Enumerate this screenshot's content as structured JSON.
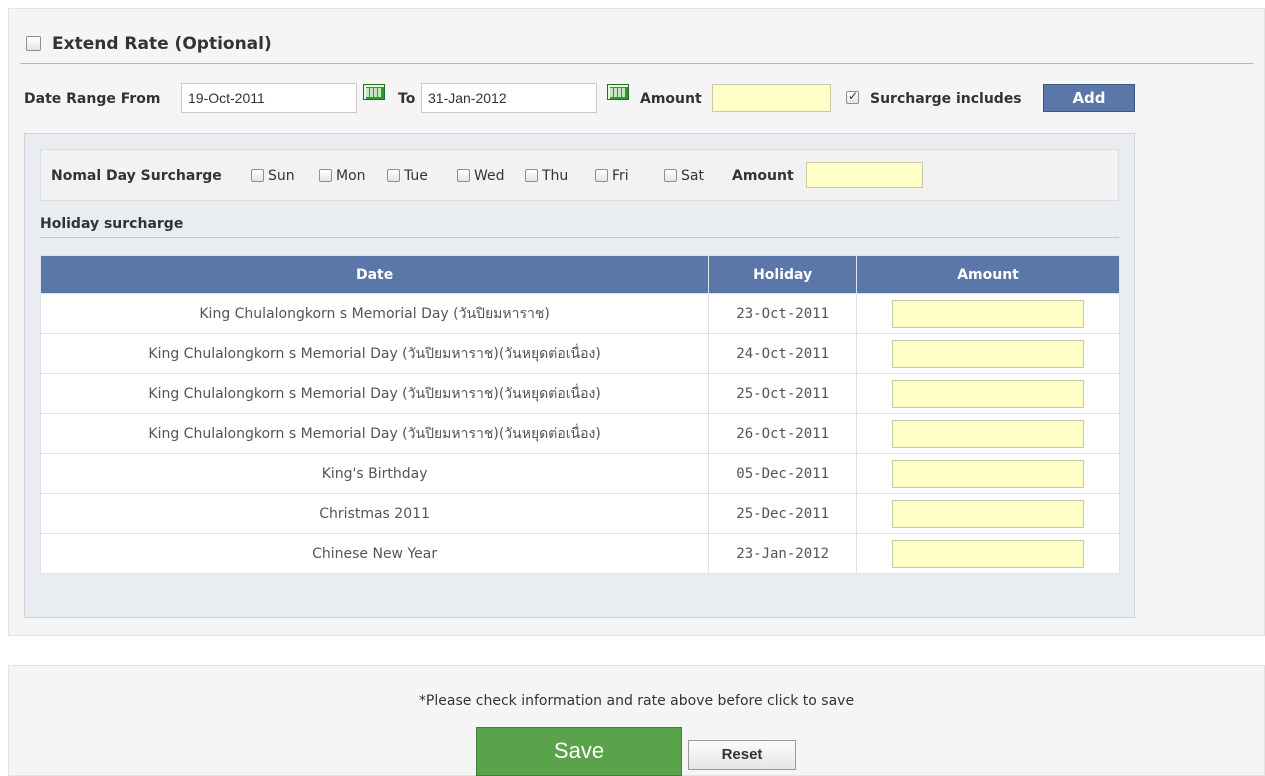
{
  "extend_rate": {
    "title": "Extend Rate (Optional)",
    "checked": false
  },
  "range": {
    "from_label": "Date Range From",
    "from_value": "19-Oct-2011",
    "to_label": "To",
    "to_value": "31-Jan-2012",
    "amount_label": "Amount",
    "amount_value": "",
    "surcharge_label": "Surcharge includes",
    "surcharge_checked": true,
    "add_label": "Add"
  },
  "normal_day": {
    "label": "Nomal Day Surcharge",
    "days": [
      "Sun",
      "Mon",
      "Tue",
      "Wed",
      "Thu",
      "Fri",
      "Sat"
    ],
    "amount_label": "Amount",
    "amount_value": ""
  },
  "holiday": {
    "title": "Holiday surcharge",
    "columns": [
      "Date",
      "Holiday",
      "Amount"
    ],
    "rows": [
      {
        "name": "King Chulalongkorn s Memorial Day (วันปิยมหาราช)",
        "date": "23-Oct-2011",
        "amount": ""
      },
      {
        "name": "King Chulalongkorn s Memorial Day (วันปิยมหาราช)(วันหยุดต่อเนื่อง)",
        "date": "24-Oct-2011",
        "amount": ""
      },
      {
        "name": "King Chulalongkorn s Memorial Day (วันปิยมหาราช)(วันหยุดต่อเนื่อง)",
        "date": "25-Oct-2011",
        "amount": ""
      },
      {
        "name": "King Chulalongkorn s Memorial Day (วันปิยมหาราช)(วันหยุดต่อเนื่อง)",
        "date": "26-Oct-2011",
        "amount": ""
      },
      {
        "name": "King's Birthday",
        "date": "05-Dec-2011",
        "amount": ""
      },
      {
        "name": "Christmas 2011",
        "date": "25-Dec-2011",
        "amount": ""
      },
      {
        "name": "Chinese New Year",
        "date": "23-Jan-2012",
        "amount": ""
      }
    ]
  },
  "footer": {
    "note": "*Please check information and rate above before click to save",
    "save_label": "Save",
    "reset_label": "Reset"
  },
  "colors": {
    "header_blue": "#5b76a8",
    "save_green": "#5aa34a",
    "input_yellow": "#ffffc8"
  }
}
